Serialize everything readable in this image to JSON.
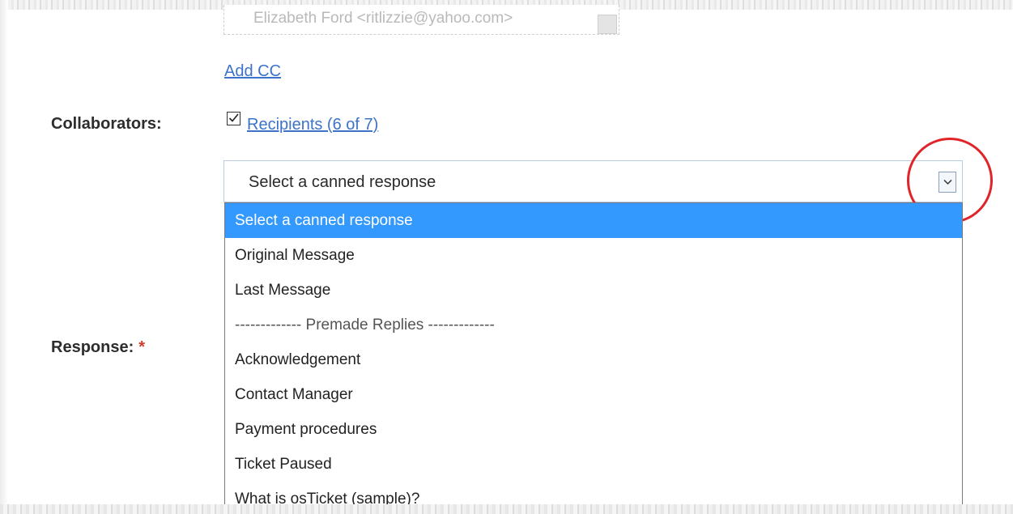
{
  "to_field": {
    "value": "Elizabeth Ford <ritlizzie@yahoo.com>"
  },
  "add_cc_label": "Add CC",
  "collaborators": {
    "label": "Collaborators:",
    "checked": true,
    "recipients_link": "Recipients (6 of 7)"
  },
  "canned_response": {
    "selected_value": "Select a canned response",
    "options": [
      "Select a canned response",
      "Original Message",
      "Last Message",
      "------------- Premade Replies -------------",
      "Acknowledgement",
      "Contact Manager",
      "Payment procedures",
      "Ticket Paused",
      "What is osTicket (sample)?"
    ]
  },
  "response": {
    "label": "Response:",
    "required_mark": "*"
  },
  "colors": {
    "link": "#3c73c8",
    "selected_option_bg": "#3399ff",
    "highlight_circle": "#e0252a",
    "required": "#d23a2a"
  }
}
